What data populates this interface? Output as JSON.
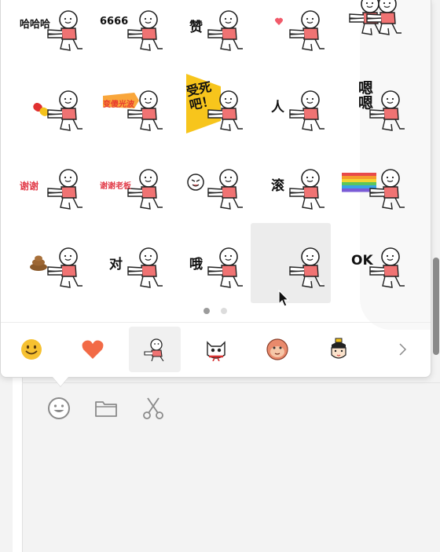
{
  "sticker_panel": {
    "stickers": [
      {
        "label": "哈哈哈",
        "kind": "text"
      },
      {
        "label": "6666",
        "kind": "text"
      },
      {
        "label": "赞",
        "kind": "text"
      },
      {
        "label": "",
        "kind": "heart-small"
      },
      {
        "label": "",
        "kind": "double"
      },
      {
        "label": "",
        "kind": "pill"
      },
      {
        "label": "变傻光波",
        "kind": "beam"
      },
      {
        "label": "受死吧！",
        "kind": "yellow-sign"
      },
      {
        "label": "人",
        "kind": "text"
      },
      {
        "label": "嗯嗯",
        "kind": "text-vertical"
      },
      {
        "label": "谢谢",
        "kind": "text-red"
      },
      {
        "label": "谢谢老板",
        "kind": "text-red"
      },
      {
        "label": "",
        "kind": "face"
      },
      {
        "label": "滚",
        "kind": "text"
      },
      {
        "label": "",
        "kind": "rainbow"
      },
      {
        "label": "",
        "kind": "poop"
      },
      {
        "label": "对",
        "kind": "text"
      },
      {
        "label": "哦",
        "kind": "text"
      },
      {
        "label": "",
        "kind": "plain"
      },
      {
        "label": "OK",
        "kind": "text"
      }
    ],
    "hover_index": 18,
    "pages": [
      {
        "active": true
      },
      {
        "active": false
      }
    ],
    "tabs": [
      {
        "name": "smiley-tab",
        "icon": "smiley-icon",
        "active": false
      },
      {
        "name": "heart-tab",
        "icon": "heart-icon",
        "active": false
      },
      {
        "name": "stickman-tab",
        "icon": "stickman-icon",
        "active": true
      },
      {
        "name": "cat-tab",
        "icon": "cat-icon",
        "active": false
      },
      {
        "name": "monkey-tab",
        "icon": "monkey-icon",
        "active": false
      },
      {
        "name": "boy-tab",
        "icon": "boy-icon",
        "active": false
      }
    ],
    "next_icon": "chevron-right-icon"
  },
  "toolbar": {
    "buttons": [
      {
        "name": "emoji-button",
        "icon": "smiley-outline-icon"
      },
      {
        "name": "file-button",
        "icon": "folder-icon"
      },
      {
        "name": "screenshot-button",
        "icon": "scissors-icon"
      }
    ]
  },
  "colors": {
    "shirt": "#f07373",
    "heart": "#f26a46",
    "smiley": "#f6c131",
    "sign": "#f7c51c",
    "scrollbar": "#8a8a8a"
  }
}
